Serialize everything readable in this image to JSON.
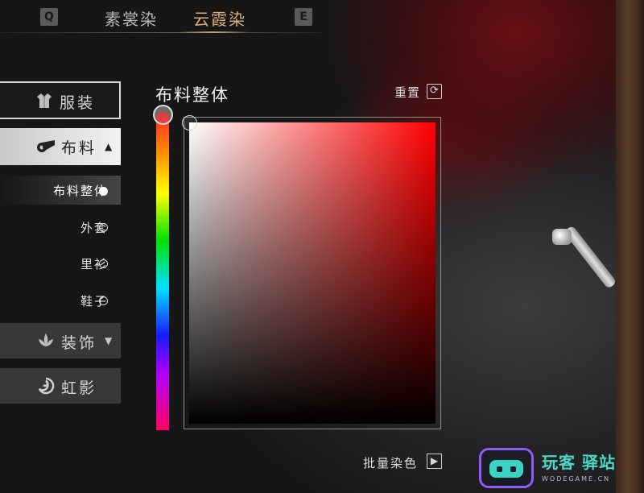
{
  "tabs": {
    "left_key": "Q",
    "right_key": "E",
    "items": [
      {
        "label": "素裳染",
        "active": false
      },
      {
        "label": "云霞染",
        "active": true
      }
    ]
  },
  "menu": {
    "clothes": {
      "label": "服装",
      "icon": "robe-icon"
    },
    "fabric": {
      "label": "布料",
      "icon": "fabric-roll-icon",
      "expanded": true
    },
    "fabric_items": [
      {
        "label": "布料整体",
        "selected": true
      },
      {
        "label": "外套",
        "selected": false
      },
      {
        "label": "里衫",
        "selected": false
      },
      {
        "label": "鞋子",
        "selected": false
      }
    ],
    "decoration": {
      "label": "装饰",
      "icon": "leaf-icon",
      "expanded": false
    },
    "rainbow": {
      "label": "虹影",
      "icon": "swirl-icon"
    }
  },
  "panel": {
    "title": "布料整体",
    "reset_label": "重置",
    "batch_label": "批量染色",
    "hue": "#e14040",
    "selected_color": "#ffffff"
  },
  "watermark": {
    "name": "玩客 驿站",
    "url": "WODEGAME.CN"
  },
  "colors": {
    "accent": "#d7b07a",
    "saturated_red": "#ff0000",
    "watermark_purple": "#8f5cf6",
    "watermark_teal": "#3ad3c6"
  }
}
